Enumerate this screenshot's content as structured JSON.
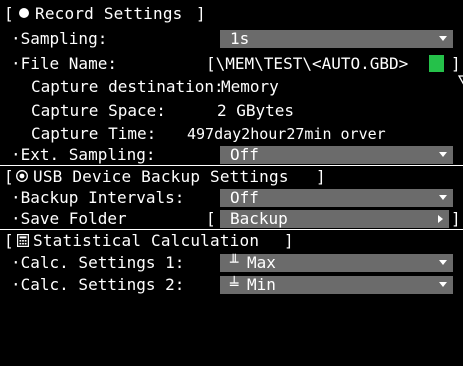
{
  "record": {
    "header_open": "[",
    "header_title": "Record Settings",
    "header_close": "]",
    "sampling_label": "·Sampling:",
    "sampling_value": "1s",
    "filename_label": "·File Name:",
    "filename_value": "[\\MEM\\TEST\\<AUTO.GBD>",
    "filename_close": "]",
    "dest_label": "Capture destination:",
    "dest_value": "Memory",
    "space_label": "Capture Space:",
    "space_value": "2 GBytes",
    "time_label": "Capture Time:",
    "time_value": "497day2hour27min orver",
    "ext_label": "·Ext. Sampling:",
    "ext_value": "Off"
  },
  "usb": {
    "header_open": "[",
    "header_title": "USB Device Backup Settings",
    "header_close": "]",
    "interval_label": "·Backup Intervals:",
    "interval_value": "Off",
    "folder_label": "·Save Folder",
    "folder_open": "[",
    "folder_value": "Backup",
    "folder_close": "]"
  },
  "stat": {
    "header_open": "[",
    "header_title": "Statistical Calculation",
    "header_close": "]",
    "calc1_label": "·Calc. Settings 1:",
    "calc1_icon": "╨",
    "calc1_value": "Max",
    "calc2_label": "·Calc. Settings 2:",
    "calc2_icon": "╧",
    "calc2_value": "Min"
  },
  "icons": {
    "record": "record-bullet-icon",
    "usb": "disc-icon",
    "stat": "calculator-icon",
    "dropdown": "dropdown-caret-icon",
    "browse": "green-triangle-icon"
  },
  "colors": {
    "background": "#000000",
    "text": "#ffffff",
    "field": "#6b6b6b",
    "accent_green": "#25c14a"
  }
}
